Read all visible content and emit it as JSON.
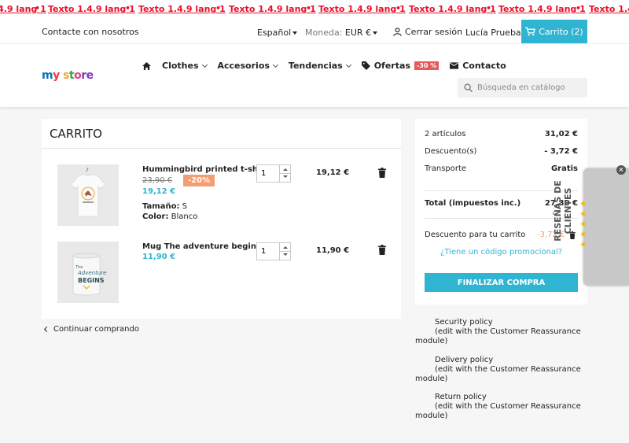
{
  "marquee": {
    "item_text": "Texto 1.4.9 lang 1",
    "separator": "•",
    "color": "#e8102a"
  },
  "topbar": {
    "contact": "Contacte con nosotros",
    "language": "Español",
    "currency_label": "Moneda:",
    "currency_value": "EUR €",
    "logout": "Cerrar sesión",
    "user": "Lucía Prueba",
    "cart": "Carrito (2)"
  },
  "header": {
    "logo": [
      "m",
      "y",
      " s",
      "t",
      "o",
      "re"
    ],
    "menu": [
      "Clothes",
      "Accesorios",
      "Tendencias",
      "Ofertas",
      "Contacto"
    ],
    "offers_badge": "-30 %",
    "search_placeholder": "Búsqueda en catálogo"
  },
  "cart": {
    "title": "CARRITO",
    "items": [
      {
        "name": "Hummingbird printed t-shirt",
        "old_price": "23,90 €",
        "discount": "-20%",
        "price": "19,12 €",
        "attrs": [
          {
            "label": "Tamaño:",
            "value": "S"
          },
          {
            "label": "Color:",
            "value": "Blanco"
          }
        ],
        "qty": "1",
        "total": "19,12 €",
        "image": "tshirt-icon"
      },
      {
        "name": "Mug The adventure begins",
        "price": "11,90 €",
        "qty": "1",
        "total": "11,90 €",
        "image": "mug-icon",
        "mug_text": [
          "The",
          "Adventure",
          "BEGINS"
        ]
      }
    ],
    "continue": "Continuar comprando"
  },
  "summary": {
    "rows": [
      {
        "label": "2 artículos",
        "value": "31,02 €"
      },
      {
        "label": "Descuento(s)",
        "value": "- 3,72 €"
      },
      {
        "label": "Transporte",
        "value": "Gratis"
      }
    ],
    "total_label": "Total (impuestos inc.)",
    "total_value": "27,30 €",
    "promo_label": "Descuento para tu carrito",
    "promo_value": "-3,72 €",
    "promo_link": "¿Tiene un código promocional?",
    "checkout": "FINALIZAR COMPRA"
  },
  "reassurance": [
    {
      "title": "Security policy",
      "note": "(edit with the Customer Reassurance",
      "note2": "module)"
    },
    {
      "title": "Delivery policy",
      "note": "(edit with the Customer Reassurance",
      "note2": "module)"
    },
    {
      "title": "Return policy",
      "note": "(edit with the Customer Reassurance",
      "note2": "module)"
    }
  ],
  "reviews_widget": {
    "label": "RESEÑAS DE CLIENTES",
    "stars": "★★★★★",
    "close": "×"
  },
  "colors": {
    "accent": "#2fb5d2",
    "discount": "#f39d72",
    "badge": "#e45b5b"
  }
}
